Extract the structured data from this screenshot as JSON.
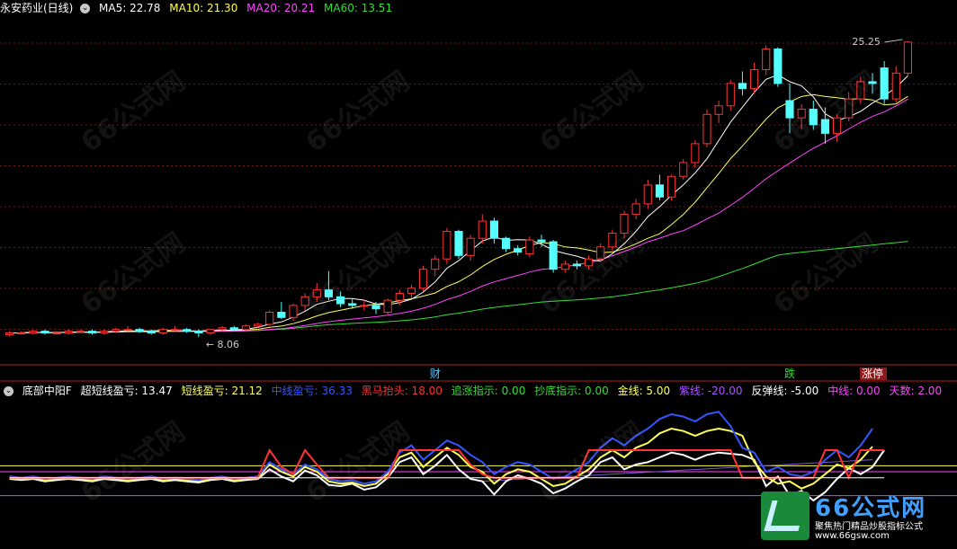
{
  "header": {
    "stock_name": "永安药业(日线)",
    "ma_items": [
      {
        "label": "MA5: 22.78",
        "color": "#ffffff"
      },
      {
        "label": "MA10: 21.30",
        "color": "#ffff55"
      },
      {
        "label": "MA20: 20.21",
        "color": "#ff44ff"
      },
      {
        "label": "MA60: 13.51",
        "color": "#33dd33"
      }
    ]
  },
  "indicator_header": {
    "name": "底部中阳F",
    "items": [
      {
        "label": "超短线盈亏: 13.47",
        "color": "#ffffff"
      },
      {
        "label": "短线盈亏: 21.12",
        "color": "#ffff55"
      },
      {
        "label": "中线盈亏: 36.33",
        "color": "#3355ff"
      },
      {
        "label": "黑马抬头: 18.00",
        "color": "#ff3333"
      },
      {
        "label": "追涨指示: 0.00",
        "color": "#33dd33"
      },
      {
        "label": "抄底指示: 0.00",
        "color": "#33dd33"
      },
      {
        "label": "金线: 5.00",
        "color": "#ffff55"
      },
      {
        "label": "紫线: -20.00",
        "color": "#aa55ff"
      },
      {
        "label": "反弹线: -5.00",
        "color": "#ffffff"
      },
      {
        "label": "中线: 0.00",
        "color": "#ff44ff"
      },
      {
        "label": "天数: 2.00",
        "color": "#ff44ff"
      }
    ]
  },
  "markers": {
    "cai": "财",
    "die": "跌",
    "zhangting": "涨停"
  },
  "logo": {
    "title": "66公式网",
    "subtitle": "聚焦热门精品炒股指标公式",
    "url": "www.66gsw.com"
  },
  "watermark": "66公式网",
  "colors": {
    "up": "#ff3333",
    "down": "#55ffff",
    "ma5": "#ffffff",
    "ma10": "#ffff55",
    "ma20": "#ff44ff",
    "ma60": "#33dd33"
  },
  "chart_data": [
    {
      "type": "candlestick",
      "title": "永安药业(日线)",
      "y_range": [
        6.5,
        26.5
      ],
      "annotations": [
        {
          "text": "25.25",
          "role": "high"
        },
        {
          "text": "8.06",
          "role": "low"
        }
      ],
      "candles": [
        {
          "o": 8.2,
          "h": 8.4,
          "l": 8.1,
          "c": 8.3
        },
        {
          "o": 8.3,
          "h": 8.4,
          "l": 8.2,
          "c": 8.3
        },
        {
          "o": 8.3,
          "h": 8.5,
          "l": 8.2,
          "c": 8.4
        },
        {
          "o": 8.4,
          "h": 8.5,
          "l": 8.2,
          "c": 8.3
        },
        {
          "o": 8.3,
          "h": 8.4,
          "l": 8.2,
          "c": 8.3
        },
        {
          "o": 8.3,
          "h": 8.5,
          "l": 8.2,
          "c": 8.4
        },
        {
          "o": 8.4,
          "h": 8.5,
          "l": 8.3,
          "c": 8.4
        },
        {
          "o": 8.4,
          "h": 8.5,
          "l": 8.2,
          "c": 8.3
        },
        {
          "o": 8.3,
          "h": 8.5,
          "l": 8.2,
          "c": 8.4
        },
        {
          "o": 8.4,
          "h": 8.6,
          "l": 8.3,
          "c": 8.5
        },
        {
          "o": 8.5,
          "h": 8.7,
          "l": 8.4,
          "c": 8.5
        },
        {
          "o": 8.5,
          "h": 8.6,
          "l": 8.3,
          "c": 8.4
        },
        {
          "o": 8.4,
          "h": 8.5,
          "l": 8.2,
          "c": 8.3
        },
        {
          "o": 8.3,
          "h": 8.6,
          "l": 8.2,
          "c": 8.5
        },
        {
          "o": 8.5,
          "h": 8.7,
          "l": 8.4,
          "c": 8.5
        },
        {
          "o": 8.5,
          "h": 8.6,
          "l": 8.3,
          "c": 8.4
        },
        {
          "o": 8.4,
          "h": 8.5,
          "l": 8.06,
          "c": 8.3
        },
        {
          "o": 8.3,
          "h": 8.5,
          "l": 8.2,
          "c": 8.5
        },
        {
          "o": 8.5,
          "h": 8.7,
          "l": 8.4,
          "c": 8.6
        },
        {
          "o": 8.6,
          "h": 8.7,
          "l": 8.4,
          "c": 8.5
        },
        {
          "o": 8.5,
          "h": 8.8,
          "l": 8.4,
          "c": 8.7
        },
        {
          "o": 8.7,
          "h": 8.9,
          "l": 8.6,
          "c": 8.8
        },
        {
          "o": 8.8,
          "h": 9.6,
          "l": 8.7,
          "c": 9.5
        },
        {
          "o": 9.5,
          "h": 10.1,
          "l": 9.1,
          "c": 9.2
        },
        {
          "o": 9.2,
          "h": 10.0,
          "l": 9.0,
          "c": 9.9
        },
        {
          "o": 9.9,
          "h": 10.6,
          "l": 9.6,
          "c": 10.4
        },
        {
          "o": 10.4,
          "h": 11.2,
          "l": 10.1,
          "c": 10.8
        },
        {
          "o": 10.8,
          "h": 11.9,
          "l": 10.2,
          "c": 10.4
        },
        {
          "o": 10.4,
          "h": 10.7,
          "l": 9.8,
          "c": 10.0
        },
        {
          "o": 10.0,
          "h": 10.3,
          "l": 9.7,
          "c": 9.9
        },
        {
          "o": 9.9,
          "h": 10.2,
          "l": 9.6,
          "c": 9.9
        },
        {
          "o": 9.9,
          "h": 10.1,
          "l": 9.4,
          "c": 9.7
        },
        {
          "o": 9.5,
          "h": 10.3,
          "l": 9.3,
          "c": 10.2
        },
        {
          "o": 10.2,
          "h": 10.8,
          "l": 9.9,
          "c": 10.6
        },
        {
          "o": 10.6,
          "h": 11.1,
          "l": 10.3,
          "c": 10.9
        },
        {
          "o": 10.9,
          "h": 12.2,
          "l": 10.7,
          "c": 12.0
        },
        {
          "o": 12.0,
          "h": 12.8,
          "l": 11.6,
          "c": 12.6
        },
        {
          "o": 12.6,
          "h": 14.4,
          "l": 12.3,
          "c": 14.2
        },
        {
          "o": 14.2,
          "h": 14.3,
          "l": 12.6,
          "c": 12.8
        },
        {
          "o": 12.8,
          "h": 14.0,
          "l": 12.5,
          "c": 13.8
        },
        {
          "o": 13.8,
          "h": 15.2,
          "l": 13.5,
          "c": 14.8
        },
        {
          "o": 14.8,
          "h": 15.0,
          "l": 13.5,
          "c": 13.8
        },
        {
          "o": 13.8,
          "h": 13.9,
          "l": 13.0,
          "c": 13.2
        },
        {
          "o": 13.2,
          "h": 13.4,
          "l": 12.8,
          "c": 13.0
        },
        {
          "o": 12.9,
          "h": 13.9,
          "l": 12.7,
          "c": 13.7
        },
        {
          "o": 13.7,
          "h": 14.0,
          "l": 13.3,
          "c": 13.6
        },
        {
          "o": 13.6,
          "h": 13.7,
          "l": 11.8,
          "c": 12.0
        },
        {
          "o": 12.0,
          "h": 12.5,
          "l": 11.8,
          "c": 12.3
        },
        {
          "o": 12.3,
          "h": 12.5,
          "l": 12.0,
          "c": 12.2
        },
        {
          "o": 12.2,
          "h": 12.8,
          "l": 12.0,
          "c": 12.6
        },
        {
          "o": 12.6,
          "h": 13.5,
          "l": 12.4,
          "c": 13.3
        },
        {
          "o": 13.3,
          "h": 14.3,
          "l": 13.1,
          "c": 14.1
        },
        {
          "o": 14.1,
          "h": 15.4,
          "l": 13.8,
          "c": 15.2
        },
        {
          "o": 15.2,
          "h": 16.1,
          "l": 14.9,
          "c": 15.8
        },
        {
          "o": 15.8,
          "h": 17.2,
          "l": 15.5,
          "c": 16.9
        },
        {
          "o": 16.9,
          "h": 17.5,
          "l": 16.0,
          "c": 16.2
        },
        {
          "o": 16.2,
          "h": 17.5,
          "l": 16.0,
          "c": 17.4
        },
        {
          "o": 17.4,
          "h": 18.4,
          "l": 17.2,
          "c": 18.2
        },
        {
          "o": 18.2,
          "h": 19.5,
          "l": 17.9,
          "c": 19.3
        },
        {
          "o": 19.3,
          "h": 21.3,
          "l": 19.1,
          "c": 21.0
        },
        {
          "o": 21.0,
          "h": 21.8,
          "l": 20.5,
          "c": 21.5
        },
        {
          "o": 21.5,
          "h": 23.0,
          "l": 21.2,
          "c": 22.8
        },
        {
          "o": 22.8,
          "h": 23.5,
          "l": 22.1,
          "c": 22.5
        },
        {
          "o": 22.5,
          "h": 24.0,
          "l": 22.2,
          "c": 23.6
        },
        {
          "o": 23.6,
          "h": 25.0,
          "l": 23.3,
          "c": 24.8
        },
        {
          "o": 24.8,
          "h": 24.9,
          "l": 22.6,
          "c": 22.8
        },
        {
          "o": 21.8,
          "h": 22.8,
          "l": 19.9,
          "c": 20.8
        },
        {
          "o": 20.8,
          "h": 21.6,
          "l": 20.1,
          "c": 21.3
        },
        {
          "o": 21.3,
          "h": 21.8,
          "l": 20.1,
          "c": 20.4
        },
        {
          "o": 20.7,
          "h": 21.4,
          "l": 19.3,
          "c": 19.9
        },
        {
          "o": 19.9,
          "h": 21.0,
          "l": 19.4,
          "c": 20.8
        },
        {
          "o": 20.8,
          "h": 22.3,
          "l": 20.6,
          "c": 21.9
        },
        {
          "o": 21.9,
          "h": 23.2,
          "l": 21.6,
          "c": 22.9
        },
        {
          "o": 22.9,
          "h": 23.4,
          "l": 22.2,
          "c": 22.8
        },
        {
          "o": 23.7,
          "h": 24.1,
          "l": 21.6,
          "c": 21.9
        },
        {
          "o": 21.9,
          "h": 23.8,
          "l": 21.7,
          "c": 23.4
        },
        {
          "o": 23.4,
          "h": 25.25,
          "l": 23.2,
          "c": 25.2
        }
      ]
    },
    {
      "type": "line",
      "title": "底部中阳F",
      "y_range": [
        -60,
        60
      ],
      "series": [
        {
          "name": "超短线盈亏",
          "color": "#ffffff",
          "values": [
            -6,
            -7,
            -6,
            -8,
            -7,
            -6,
            -7,
            -8,
            -6,
            -7,
            -8,
            -7,
            -6,
            -8,
            -7,
            -8,
            -9,
            -7,
            -6,
            -8,
            -7,
            -6,
            2,
            -4,
            -8,
            1,
            -3,
            -11,
            -12,
            -10,
            -15,
            -13,
            -5,
            8,
            12,
            -2,
            5,
            14,
            2,
            -6,
            -8,
            -19,
            -8,
            -3,
            -6,
            -10,
            -18,
            -14,
            -8,
            -3,
            8,
            12,
            2,
            6,
            8,
            12,
            16,
            14,
            10,
            14,
            16,
            15,
            14,
            10,
            -12,
            -4,
            -20,
            -16,
            -24,
            -17,
            -6,
            3,
            -2,
            4,
            18
          ]
        },
        {
          "name": "短线盈亏",
          "color": "#ffff55",
          "values": [
            -5,
            -6,
            -5,
            -7,
            -6,
            -5,
            -6,
            -7,
            -5,
            -6,
            -7,
            -6,
            -5,
            -7,
            -6,
            -7,
            -8,
            -6,
            -5,
            -7,
            -6,
            -5,
            6,
            0,
            -4,
            4,
            0,
            -8,
            -10,
            -9,
            -12,
            -10,
            -2,
            12,
            16,
            4,
            12,
            20,
            14,
            4,
            0,
            -10,
            -2,
            2,
            0,
            -6,
            -12,
            -10,
            -4,
            2,
            12,
            18,
            12,
            20,
            24,
            32,
            36,
            34,
            30,
            34,
            36,
            34,
            30,
            8,
            -4,
            -10,
            -8,
            -14,
            -10,
            -2,
            6,
            3,
            10,
            21
          ]
        },
        {
          "name": "中线盈亏",
          "color": "#3355ff",
          "values": [
            -4,
            -5,
            -4,
            -6,
            -5,
            -4,
            -5,
            -6,
            -4,
            -5,
            -6,
            -5,
            -4,
            -6,
            -5,
            -6,
            -7,
            -5,
            -4,
            -6,
            -5,
            -4,
            8,
            2,
            -2,
            6,
            2,
            -6,
            -8,
            -7,
            -10,
            -8,
            0,
            16,
            22,
            10,
            18,
            26,
            22,
            14,
            8,
            -2,
            4,
            8,
            6,
            0,
            -6,
            -4,
            2,
            8,
            20,
            28,
            22,
            30,
            36,
            44,
            48,
            46,
            42,
            48,
            50,
            38,
            20,
            16,
            0,
            4,
            -2,
            -4,
            0,
            10,
            18,
            12,
            22,
            36
          ]
        },
        {
          "name": "黑马抬头",
          "color": "#ff3333",
          "values": [
            -5,
            -5,
            -5,
            -5,
            -5,
            -5,
            -5,
            -5,
            -5,
            -5,
            -5,
            -5,
            -5,
            -5,
            -5,
            -5,
            -5,
            -5,
            -5,
            -5,
            -5,
            -5,
            18,
            4,
            -2,
            18,
            6,
            -5,
            -5,
            -5,
            -5,
            -5,
            -5,
            18,
            18,
            18,
            18,
            18,
            18,
            6,
            -2,
            -5,
            -5,
            -5,
            -5,
            -5,
            -5,
            -5,
            -5,
            18,
            18,
            18,
            18,
            18,
            18,
            18,
            18,
            18,
            18,
            18,
            18,
            18,
            -5,
            -5,
            -5,
            -5,
            -5,
            -5,
            -5,
            18,
            18,
            -5,
            18,
            18,
            18
          ]
        },
        {
          "name": "反弹线",
          "color": "#ffffff",
          "values": [
            -5,
            -5,
            -5,
            -5,
            -5,
            -5,
            -5,
            -5,
            -5,
            -5,
            -5,
            -5,
            -5,
            -5,
            -5,
            -5,
            -5,
            -5,
            -5,
            -5,
            -5,
            -5,
            -5,
            -5,
            -5,
            -5,
            -5,
            -5,
            -5,
            -5,
            -5,
            -5,
            -5,
            -5,
            -5,
            -5,
            -5,
            -5,
            -5,
            -5,
            -5,
            -5,
            -5,
            -5,
            -5,
            -5,
            -5,
            -5,
            -5,
            -5,
            -5,
            -5,
            -5,
            -5,
            -5,
            -5,
            -5,
            -5,
            -5,
            -5,
            -5,
            -5,
            -5,
            -5,
            -5,
            -5,
            -5,
            -5,
            -5,
            -5,
            -5,
            -5,
            -5,
            -5,
            -5
          ]
        }
      ],
      "reference_lines": [
        {
          "name": "金线",
          "value": 5,
          "color": "#ffff55"
        },
        {
          "name": "中线",
          "value": 0,
          "color": "#ff44ff"
        },
        {
          "name": "紫线",
          "value": -20,
          "color": "#aa55ff"
        }
      ]
    }
  ]
}
